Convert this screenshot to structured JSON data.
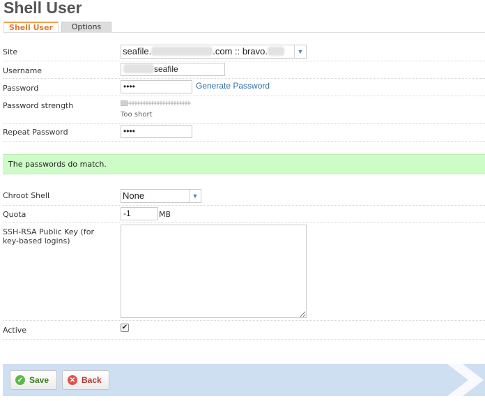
{
  "page": {
    "title": "Shell User"
  },
  "tabs": [
    {
      "label": "Shell User"
    },
    {
      "label": "Options"
    }
  ],
  "form": {
    "site": {
      "label": "Site",
      "value_prefix": "seafile.",
      "value_mid": ".com :: bravo."
    },
    "username": {
      "label": "Username",
      "value": "seafile"
    },
    "password": {
      "label": "Password",
      "value": "••••",
      "generate_link": "Generate Password"
    },
    "password_strength": {
      "label": "Password strength",
      "hint": "Too short",
      "level": 0.0
    },
    "repeat_password": {
      "label": "Repeat Password",
      "value": "••••"
    },
    "match_message": "The passwords do match.",
    "chroot_shell": {
      "label": "Chroot Shell",
      "value": "None"
    },
    "quota": {
      "label": "Quota",
      "value": "-1",
      "unit": "MB"
    },
    "ssh_key": {
      "label_line1": "SSH-RSA Public Key (for",
      "label_line2": "key-based logins)",
      "value": ""
    },
    "active": {
      "label": "Active",
      "checked": true
    }
  },
  "actions": {
    "save_label": "Save",
    "back_label": "Back"
  },
  "colors": {
    "tab_active": "#e8782e",
    "success_bg": "#cdfcc6",
    "link": "#2f6ea5",
    "footer_bg": "#cfdff2"
  },
  "icons": {
    "save": "check-circle-icon",
    "back": "x-circle-icon",
    "select": "triangle-down-icon"
  }
}
